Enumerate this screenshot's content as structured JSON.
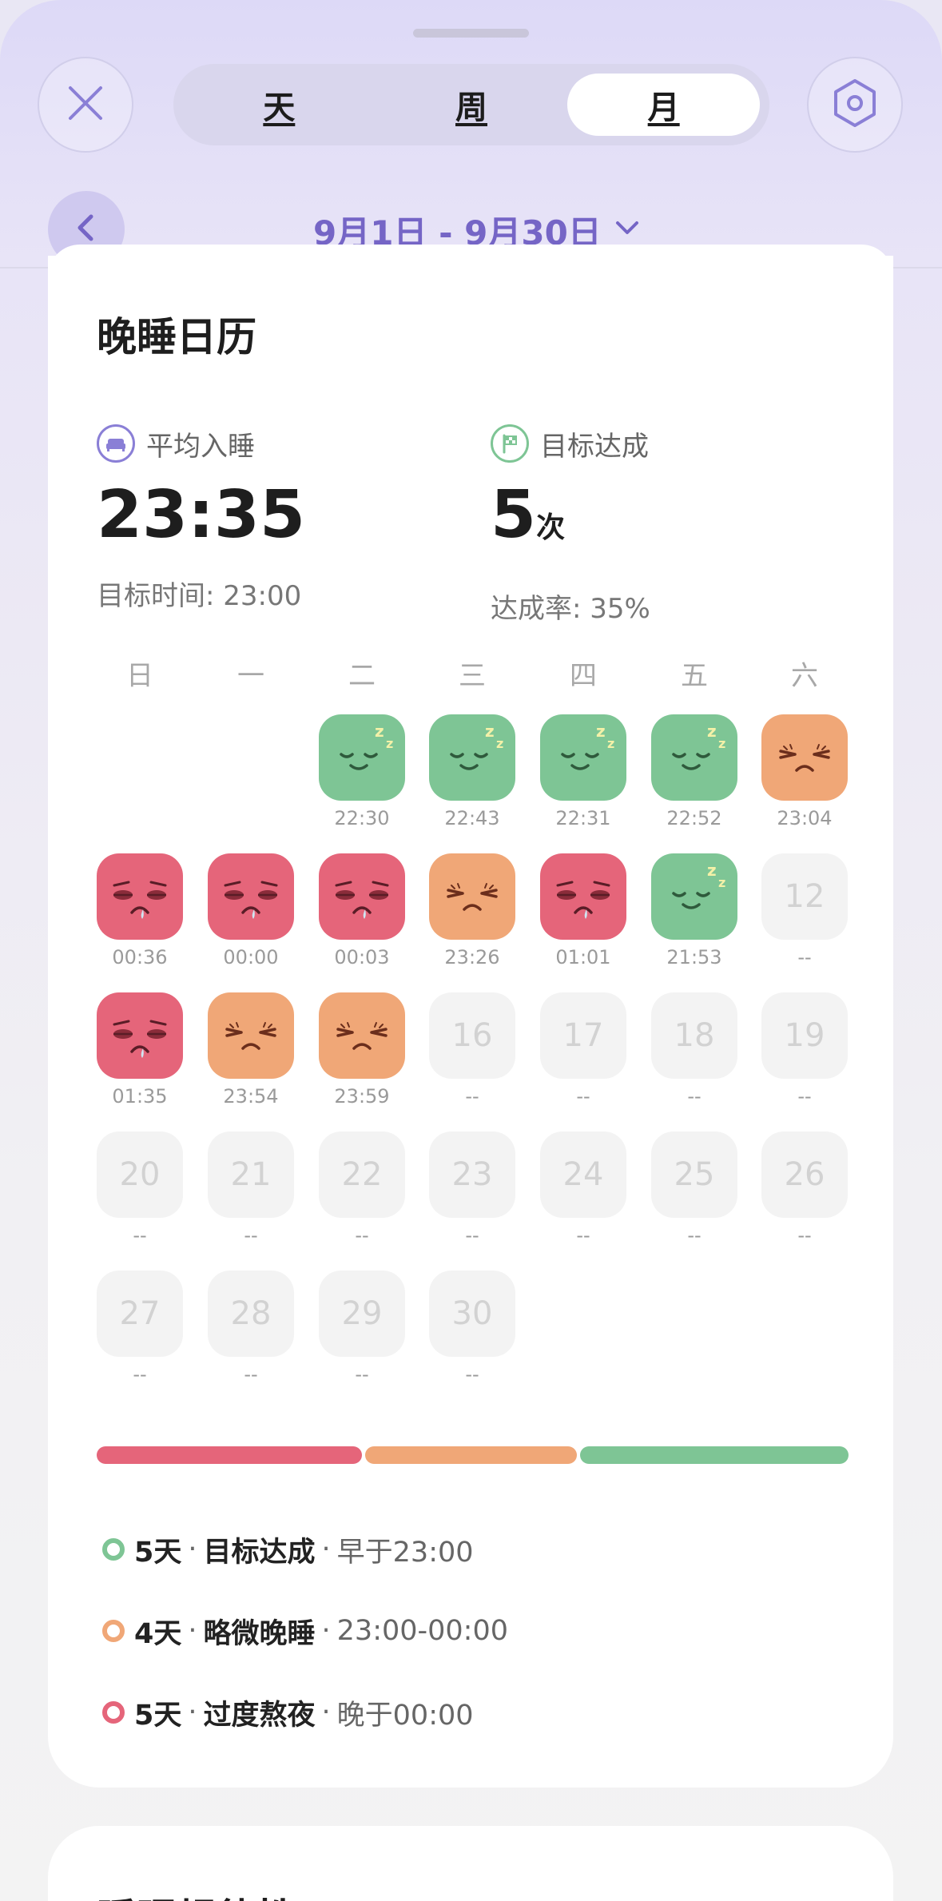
{
  "header": {
    "tabs": [
      {
        "label": "天",
        "active": false
      },
      {
        "label": "周",
        "active": false
      },
      {
        "label": "月",
        "active": true
      }
    ],
    "date_range": "9月1日 - 9月30日"
  },
  "card": {
    "title": "晚睡日历",
    "avg_label": "平均入睡",
    "avg_value": "23:35",
    "avg_sub": "目标时间: 23:00",
    "goal_label": "目标达成",
    "goal_value": "5",
    "goal_unit": "次",
    "goal_sub": "达成率: 35%",
    "weekdays": [
      "日",
      "一",
      "二",
      "三",
      "四",
      "五",
      "六"
    ],
    "days": [
      {
        "day": 1,
        "status": "good",
        "time": "22:30"
      },
      {
        "day": 2,
        "status": "good",
        "time": "22:43"
      },
      {
        "day": 3,
        "status": "good",
        "time": "22:31"
      },
      {
        "day": 4,
        "status": "good",
        "time": "22:52"
      },
      {
        "day": 5,
        "status": "slight",
        "time": "23:04"
      },
      {
        "day": 6,
        "status": "late",
        "time": "00:36"
      },
      {
        "day": 7,
        "status": "late",
        "time": "00:00"
      },
      {
        "day": 8,
        "status": "late",
        "time": "00:03"
      },
      {
        "day": 9,
        "status": "slight",
        "time": "23:26"
      },
      {
        "day": 10,
        "status": "late",
        "time": "01:01"
      },
      {
        "day": 11,
        "status": "good",
        "time": "21:53"
      },
      {
        "day": 12,
        "status": "none",
        "time": "--"
      },
      {
        "day": 13,
        "status": "late",
        "time": "01:35"
      },
      {
        "day": 14,
        "status": "slight",
        "time": "23:54"
      },
      {
        "day": 15,
        "status": "slight",
        "time": "23:59"
      },
      {
        "day": 16,
        "status": "none",
        "time": "--"
      },
      {
        "day": 17,
        "status": "none",
        "time": "--"
      },
      {
        "day": 18,
        "status": "none",
        "time": "--"
      },
      {
        "day": 19,
        "status": "none",
        "time": "--"
      },
      {
        "day": 20,
        "status": "none",
        "time": "--"
      },
      {
        "day": 21,
        "status": "none",
        "time": "--"
      },
      {
        "day": 22,
        "status": "none",
        "time": "--"
      },
      {
        "day": 23,
        "status": "none",
        "time": "--"
      },
      {
        "day": 24,
        "status": "none",
        "time": "--"
      },
      {
        "day": 25,
        "status": "none",
        "time": "--"
      },
      {
        "day": 26,
        "status": "none",
        "time": "--"
      },
      {
        "day": 27,
        "status": "none",
        "time": "--"
      },
      {
        "day": 28,
        "status": "none",
        "time": "--"
      },
      {
        "day": 29,
        "status": "none",
        "time": "--"
      },
      {
        "day": 30,
        "status": "none",
        "time": "--"
      }
    ],
    "distribution": [
      {
        "status": "late",
        "days": 5
      },
      {
        "status": "slight",
        "days": 4
      },
      {
        "status": "good",
        "days": 5
      }
    ],
    "legend": [
      {
        "count": "5天",
        "label": "目标达成",
        "range": "早于23:00",
        "color": "#7ec595"
      },
      {
        "count": "4天",
        "label": "略微晚睡",
        "range": "23:00-00:00",
        "color": "#f0a777"
      },
      {
        "count": "5天",
        "label": "过度熬夜",
        "range": "晚于00:00",
        "color": "#e5657a"
      }
    ],
    "separator": "·"
  },
  "card2": {
    "title": "睡眠规律性"
  },
  "colors": {
    "good": "#7ec595",
    "slight": "#f0a777",
    "late": "#e5657a",
    "accent": "#7565c6"
  }
}
